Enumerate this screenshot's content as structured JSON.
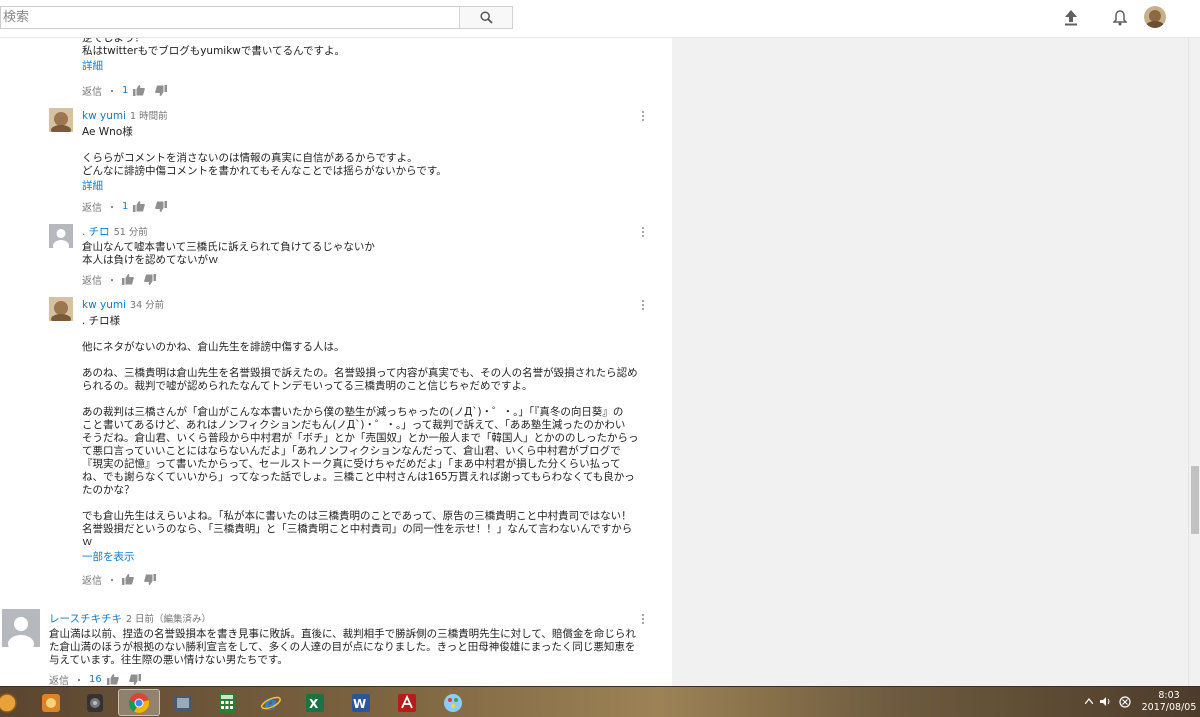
{
  "search": {
    "placeholder": "検索"
  },
  "comments": [
    {
      "author": "",
      "time": "",
      "text": "逆でしよう？\n私はtwitterもでブログもyumikwで書いてるんですよ。",
      "more": "詳細",
      "reply": "返信",
      "likes": "1"
    },
    {
      "author": "kw yumi",
      "time": "1 時間前",
      "text": "Ae Wno様\n\nくららがコメントを消さないのは情報の真実に自信があるからですよ。\nどんなに誹謗中傷コメントを書かれてもそんなことでは揺らがないからです。",
      "more": "詳細",
      "reply": "返信",
      "likes": "1"
    },
    {
      "author": ". チロ",
      "time": "51 分前",
      "text": "倉山なんて嘘本書いて三橋氏に訴えられて負けてるじゃないか\n本人は負けを認めてないがｗ",
      "more": "",
      "reply": "返信",
      "likes": ""
    },
    {
      "author": "kw yumi",
      "time": "34 分前",
      "text": ". チロ様\n\n他にネタがないのかね、倉山先生を誹謗中傷する人は。\n\nあのね、三橋貴明は倉山先生を名誉毀損で訴えたの。名誉毀損って内容が真実でも、その人の名誉が毀損されたら認め\nられるの。裁判で嘘が認められたなんてトンデモいってる三橋貴明のこと信じちゃだめですよ。\n\nあの裁判は三橋さんが「倉山がこんな本書いたから僕の塾生が減っちゃったの(ノД`)・゜・。」「『真冬の向日葵』の\nこと書いてあるけど、あれはノンフィクションだもん(ノД`)・゜・。」って裁判で訴えて、「ああ塾生減ったのかわい\nそうだね。倉山君、いくら普段から中村君が「ボチ」とか「売国奴」とか一般人まで「韓国人」とかののしったからっ\nて悪口言っていいことにはならないんだよ」「あれノンフィクションなんだって、倉山君、いくら中村君がブログで\n『現実の記憶』って書いたからって、セールストーク真に受けちゃだめだよ」「まあ中村君が損した分くらい払って\nね、でも謝らなくていいから」ってなった話でしょ。三橋こと中村さんは165万貰えれば謝ってもらわなくても良かっ\nたのかな？\n\nでも倉山先生はえらいよね。「私が本に書いたのは三橋貴明のことであって、原告の三橋貴明こと中村貴司ではない！\n名誉毀損だというのなら、「三橋貴明」と「三橋貴明こと中村貴司」の同一性を示せ！！」なんて言わないんですから\nｗ",
      "more": "一部を表示",
      "reply": "返信",
      "likes": ""
    },
    {
      "author": "レースチキチキ",
      "time": "2 日前（編集済み）",
      "text": "倉山満は以前、捏造の名誉毀損本を書き見事に敗訴。直後に、裁判相手で勝訴側の三橋貴明先生に対して、賠償金を命じられ\nた倉山満のほうが根拠のない勝利宣言をして、多くの人達の目が点になりました。きっと田母神俊雄にまったく同じ悪知恵を\n与えています。往生際の悪い情けない男たちです。",
      "more": "",
      "reply": "返信",
      "likes": "16"
    }
  ],
  "clock": {
    "time": "8:03",
    "date": "2017/08/05"
  },
  "colors": {
    "link": "#167ac6",
    "sidebar": "#f1f1f1"
  }
}
